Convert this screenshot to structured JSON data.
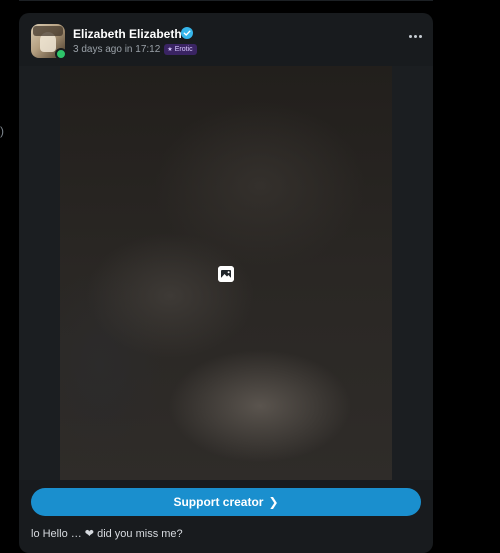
{
  "colors": {
    "background": "#000000",
    "card": "#181b1e",
    "accent": "#1a8fce",
    "verified": "#35b5ea",
    "online": "#2ec46a",
    "badge": "#3a2463"
  },
  "sidebar_fragment": ")",
  "post": {
    "author_name": "Elizabeth Elizabeth",
    "verified_icon": "verified-check-icon",
    "meta": "3 days ago in 17:12",
    "category": "Erotic",
    "category_icon": "star-icon",
    "more_icon": "more-dots-icon",
    "media_icon": "image-icon",
    "support_label": "Support creator",
    "support_icon": "chevron-right-icon",
    "caption": "lo Hello …  ❤ did you miss me?"
  }
}
